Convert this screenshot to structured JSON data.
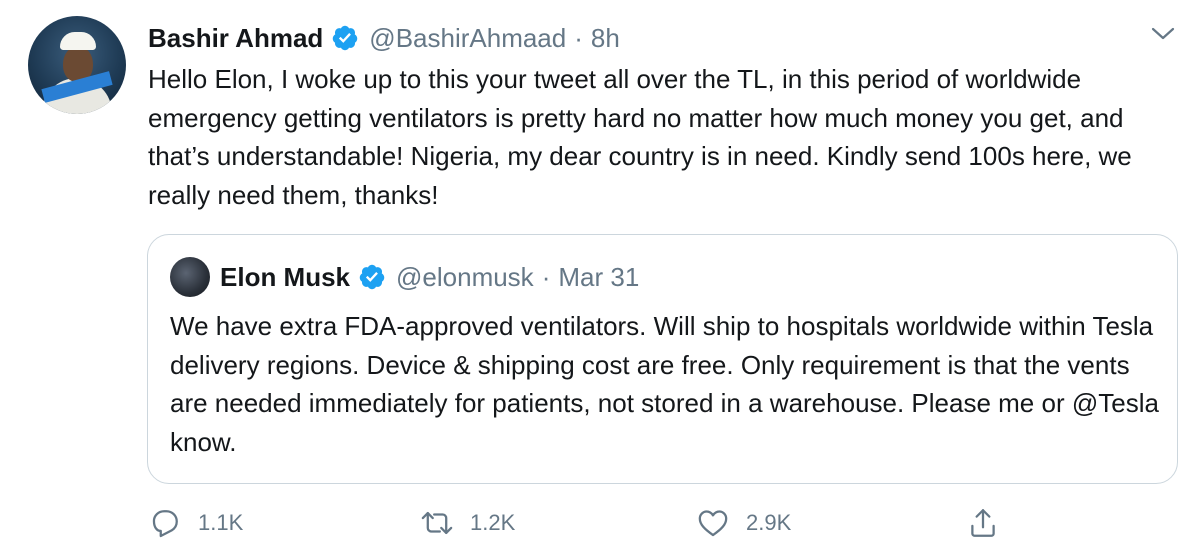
{
  "tweet": {
    "author_name": "Bashir Ahmad",
    "author_handle": "@BashirAhmaad",
    "time_separator": "·",
    "time": "8h",
    "text": "Hello Elon, I woke up to this your tweet all over the TL, in this period of worldwide emergency getting ventilators is pretty hard no matter how much money you get, and that’s understandable! Nigeria, my dear country is in need. Kindly send 100s here, we really need them, thanks!",
    "verified": true
  },
  "quoted_tweet": {
    "author_name": "Elon Musk",
    "author_handle": "@elonmusk",
    "time_separator": "·",
    "time": "Mar 31",
    "text": "We have extra FDA-approved ventilators. Will ship to hospitals worldwide within Tesla delivery regions. Device & shipping cost are free. Only requirement is that the vents are needed immediately for patients, not stored in a warehouse. Please me or @Tesla know.",
    "verified": true
  },
  "actions": {
    "reply": {
      "icon": "reply-icon",
      "count": "1.1K"
    },
    "retweet": {
      "icon": "retweet-icon",
      "count": "1.2K"
    },
    "like": {
      "icon": "heart-icon",
      "count": "2.9K"
    },
    "share": {
      "icon": "share-icon",
      "count": ""
    }
  },
  "colors": {
    "text": "#14171a",
    "secondary": "#657786",
    "verified": "#1da1f2",
    "border": "#ccd6dd"
  }
}
